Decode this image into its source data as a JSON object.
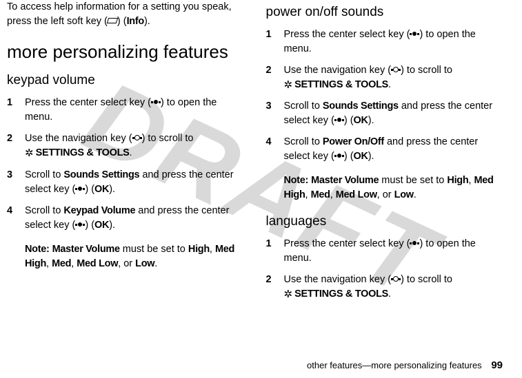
{
  "watermark": "DRAFT",
  "left": {
    "intro_a": "To access help information for a setting you speak, press the left soft key (",
    "intro_b": ") (",
    "intro_label": "Info",
    "intro_c": ").",
    "h1": "more personalizing features",
    "h2": "keypad volume",
    "steps": [
      {
        "n": "1",
        "a": "Press the center select key (",
        "b": ") to open the menu."
      },
      {
        "n": "2",
        "a": "Use the navigation key (",
        "b": ") to scroll to ",
        "icon": "✲",
        "target": "SETTINGS & TOOLS",
        "c": "."
      },
      {
        "n": "3",
        "a": "Scroll to ",
        "target": "Sounds Settings",
        "b": " and press the center select key (",
        "c": ") (",
        "ok": "OK",
        "d": ")."
      },
      {
        "n": "4",
        "a": "Scroll to ",
        "target": "Keypad Volume",
        "b": " and press the center select key (",
        "c": ") (",
        "ok": "OK",
        "d": ")."
      }
    ],
    "note_label": "Note:",
    "note_a": " ",
    "note_mv": "Master Volume",
    "note_b": " must be set to ",
    "opts": [
      "High",
      "Med High",
      "Med",
      "Med Low",
      "Low"
    ],
    "note_c": "."
  },
  "right": {
    "h2a": "power on/off sounds",
    "stepsA": [
      {
        "n": "1",
        "a": "Press the center select key (",
        "b": ") to open the menu."
      },
      {
        "n": "2",
        "a": "Use the navigation key (",
        "b": ") to scroll to ",
        "icon": "✲",
        "target": "SETTINGS & TOOLS",
        "c": "."
      },
      {
        "n": "3",
        "a": "Scroll to ",
        "target": "Sounds Settings",
        "b": " and press the center select key (",
        "c": ") (",
        "ok": "OK",
        "d": ")."
      },
      {
        "n": "4",
        "a": "Scroll to ",
        "target": "Power On/Off",
        "b": " and press the center select key (",
        "c": ") (",
        "ok": "OK",
        "d": ")."
      }
    ],
    "note_label": "Note:",
    "note_mv": "Master Volume",
    "note_b": " must be set to ",
    "opts": [
      "High",
      "Med High",
      "Med",
      "Med Low",
      "Low"
    ],
    "note_c": ".",
    "h2b": "languages",
    "stepsB": [
      {
        "n": "1",
        "a": "Press the center select key (",
        "b": ") to open the menu."
      },
      {
        "n": "2",
        "a": "Use the navigation key (",
        "b": ") to scroll to ",
        "icon": "✲",
        "target": "SETTINGS & TOOLS",
        "c": "."
      }
    ]
  },
  "footer": "other features—more personalizing features",
  "page": "99",
  "sep_comma": ", ",
  "sep_or": ", or "
}
